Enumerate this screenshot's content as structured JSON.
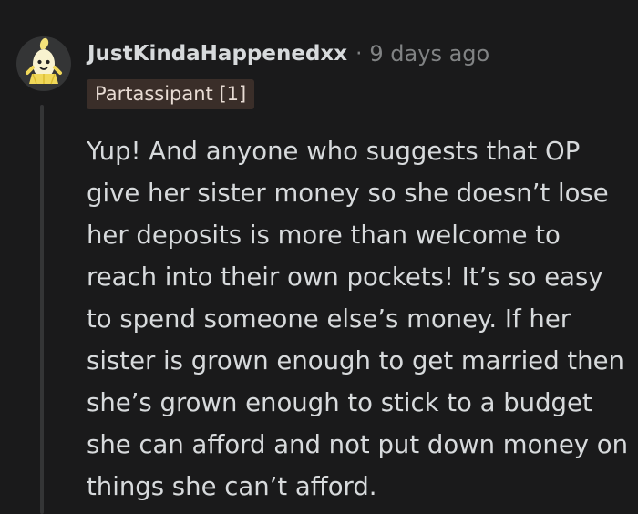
{
  "comment": {
    "avatar": {
      "icon": "banana-character-icon",
      "bg_color": "#343536"
    },
    "username": "JustKindaHappenedxx",
    "separator": "·",
    "timestamp": "9 days ago",
    "flair": "Partassipant [1]",
    "body": "Yup! And anyone who suggests that OP give her sister money so she doesn’t lose her deposits is more than welcome to reach into their own pockets! It’s so easy to spend someone else’s money. If her sister is grown enough to get married then she’s grown enough to stick to a budget she can afford and not put down money on things she can’t afford."
  },
  "colors": {
    "background": "#1a1a1b",
    "text": "#d7dadc",
    "meta_text": "#818384",
    "flair_bg": "#3a2e29",
    "thread_line": "#343536"
  }
}
